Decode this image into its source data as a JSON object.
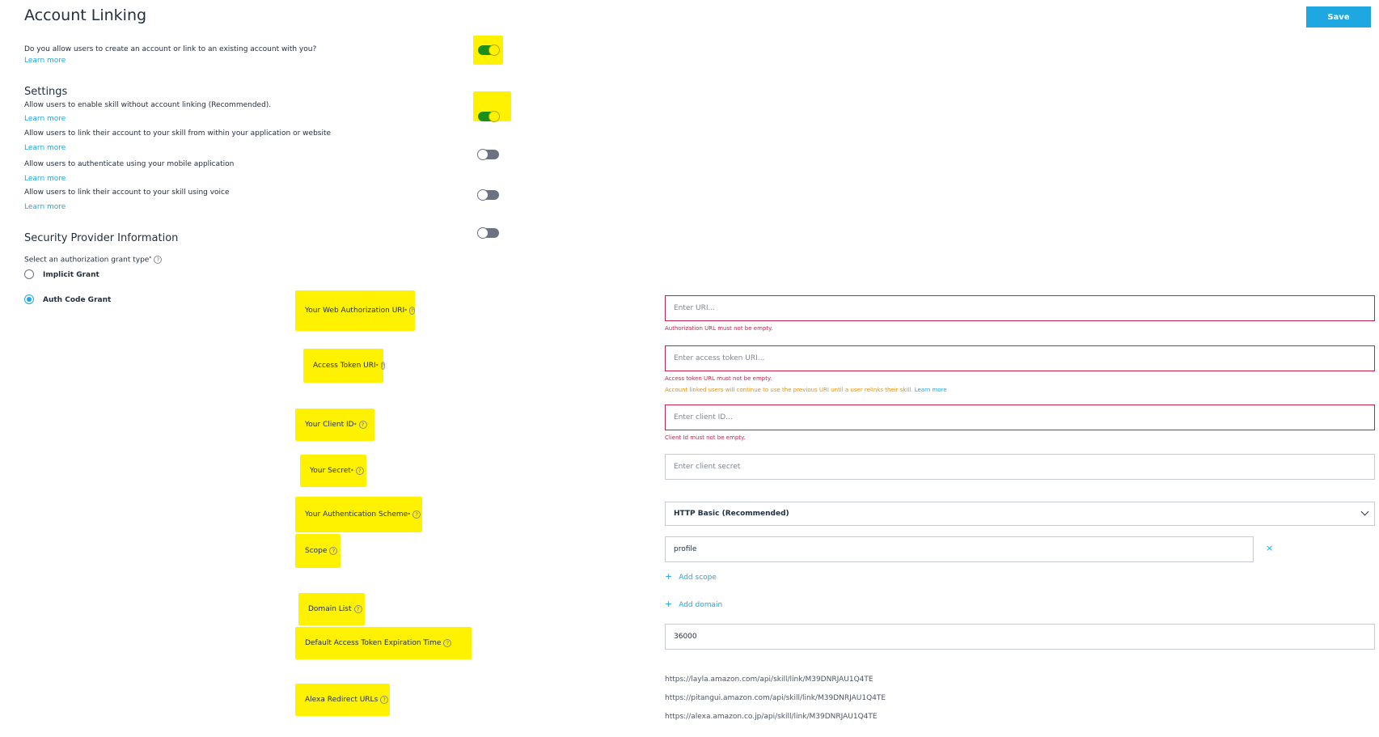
{
  "header": {
    "title": "Account Linking",
    "save_label": "Save"
  },
  "account_linking": {
    "question": "Do you allow users to create an account or link to an existing account with you?",
    "learn_more": "Learn more",
    "enabled": true
  },
  "settings": {
    "title": "Settings",
    "items": [
      {
        "label": "Allow users to enable skill without account linking (Recommended).",
        "learn_more": "Learn more",
        "enabled": true
      },
      {
        "label": "Allow users to link their account to your skill from within your application or website",
        "learn_more": "Learn more",
        "enabled": false
      },
      {
        "label": "Allow users to authenticate using your mobile application",
        "learn_more": "Learn more",
        "enabled": false
      },
      {
        "label": "Allow users to link their account to your skill using voice",
        "learn_more": "Learn more",
        "enabled": false
      }
    ]
  },
  "security": {
    "title": "Security Provider Information",
    "grant_prompt": "Select an authorization grant type",
    "req_mark": "*",
    "help_glyph": "?",
    "grants": [
      {
        "label": "Implicit Grant",
        "selected": false
      },
      {
        "label": "Auth Code Grant",
        "selected": true
      }
    ]
  },
  "fields": {
    "auth_uri": {
      "label": "Your Web Authorization URI",
      "placeholder": "Enter URI...",
      "error": "Authorization URL must not be empty."
    },
    "token_uri": {
      "label": "Access Token URI",
      "placeholder": "Enter access token URI...",
      "error": "Access token URL must not be empty.",
      "warning": "Account linked users will continue to use the previous URI until a user relinks their skill.",
      "warning_link": "Learn more"
    },
    "client_id": {
      "label": "Your Client ID",
      "placeholder": "Enter client ID...",
      "error": "Client Id must not be empty."
    },
    "secret": {
      "label": "Your Secret",
      "placeholder": "Enter client secret"
    },
    "auth_scheme": {
      "label": "Your Authentication Scheme",
      "value": "HTTP Basic (Recommended)"
    },
    "scope": {
      "label": "Scope",
      "value": "profile",
      "remove_glyph": "×",
      "add_label": "Add scope"
    },
    "domain_list": {
      "label": "Domain List",
      "add_label": "Add domain"
    },
    "expiration": {
      "label": "Default Access Token Expiration Time",
      "value": "36000"
    },
    "redirects": {
      "label": "Alexa Redirect URLs",
      "urls": [
        "https://layla.amazon.com/api/skill/link/M39DNRJAU1Q4TE",
        "https://pitangui.amazon.com/api/skill/link/M39DNRJAU1Q4TE",
        "https://alexa.amazon.co.jp/api/skill/link/M39DNRJAU1Q4TE"
      ]
    }
  },
  "colors": {
    "accent": "#1ea7e1",
    "error": "#cc1f46",
    "warning": "#e88f00",
    "highlight": "#fff200",
    "toggle_on": "#1a8f1a"
  }
}
